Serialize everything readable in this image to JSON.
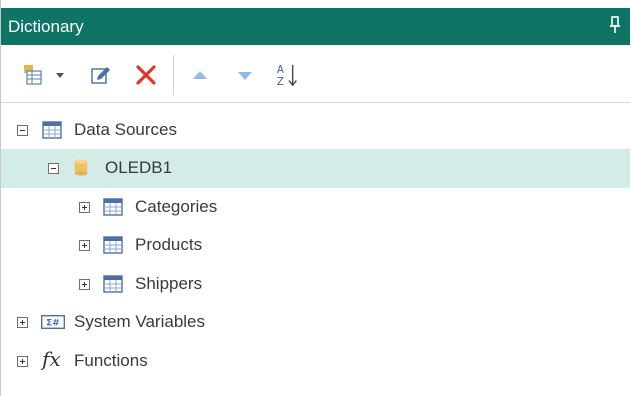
{
  "panel": {
    "title": "Dictionary"
  },
  "toolbar": {
    "buttons": [
      {
        "icon": "new-item-dropdown-icon"
      },
      {
        "icon": "edit-icon"
      },
      {
        "icon": "delete-icon"
      },
      {
        "icon": "move-up-icon"
      },
      {
        "icon": "move-down-icon"
      },
      {
        "icon": "sort-az-icon",
        "glyph_top": "A",
        "glyph_bottom": "Z"
      }
    ]
  },
  "tree": {
    "data_sources": {
      "label": "Data Sources",
      "expanded": true
    },
    "connection": {
      "label": "OLEDB1",
      "expanded": true,
      "selected": true
    },
    "tables": [
      {
        "label": "Categories",
        "expanded": false
      },
      {
        "label": "Products",
        "expanded": false
      },
      {
        "label": "Shippers",
        "expanded": false
      }
    ],
    "system_variables": {
      "label": "System Variables",
      "badge": "Σ#",
      "expanded": false
    },
    "functions": {
      "label": "Functions",
      "glyph": "fx",
      "expanded": false
    }
  },
  "colors": {
    "title_bar": "#0e7566",
    "selected_row": "#d3ece8",
    "delete": "#e0362b",
    "arrows": "#8fbbe3"
  }
}
